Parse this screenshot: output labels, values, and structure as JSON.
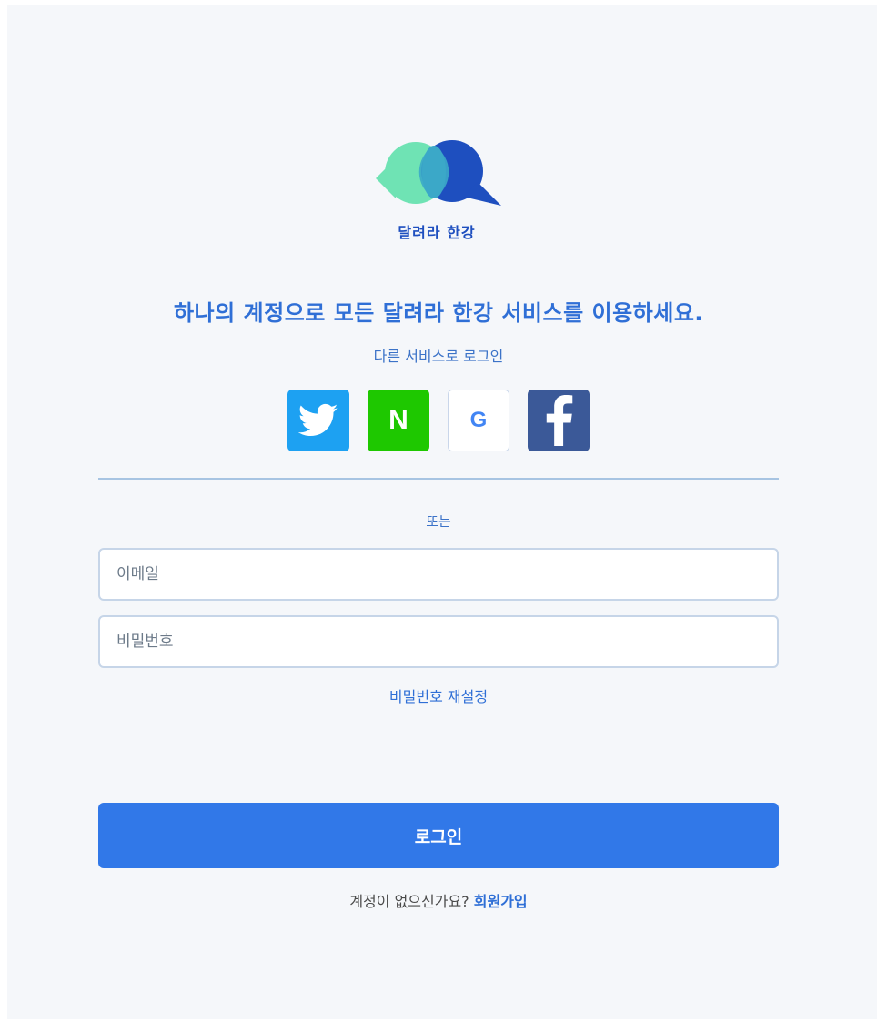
{
  "brand": {
    "name": "달려라 한강",
    "colors": {
      "primary": "#3178e8",
      "logo_mint": "#6fe3b4",
      "logo_navy": "#1e4fbf"
    }
  },
  "headline": "하나의 계정으로 모든 달려라 한강 서비스를 이용하세요.",
  "social": {
    "label": "다른 서비스로 로그인",
    "providers": [
      {
        "name": "twitter",
        "icon": "twitter-bird-icon",
        "color": "#1da1f2"
      },
      {
        "name": "naver",
        "icon": "naver-n-icon",
        "glyph": "N",
        "color": "#1ec800"
      },
      {
        "name": "google",
        "icon": "google-g-icon",
        "glyph": "G",
        "color": "#4285f4"
      },
      {
        "name": "facebook",
        "icon": "facebook-f-icon",
        "color": "#3b5998"
      }
    ]
  },
  "separator": "또는",
  "form": {
    "email_placeholder": "이메일",
    "password_placeholder": "비밀번호",
    "reset_label": "비밀번호 재설정",
    "login_label": "로그인"
  },
  "signup": {
    "prompt": "계정이 없으신가요?",
    "link": "회원가입"
  }
}
